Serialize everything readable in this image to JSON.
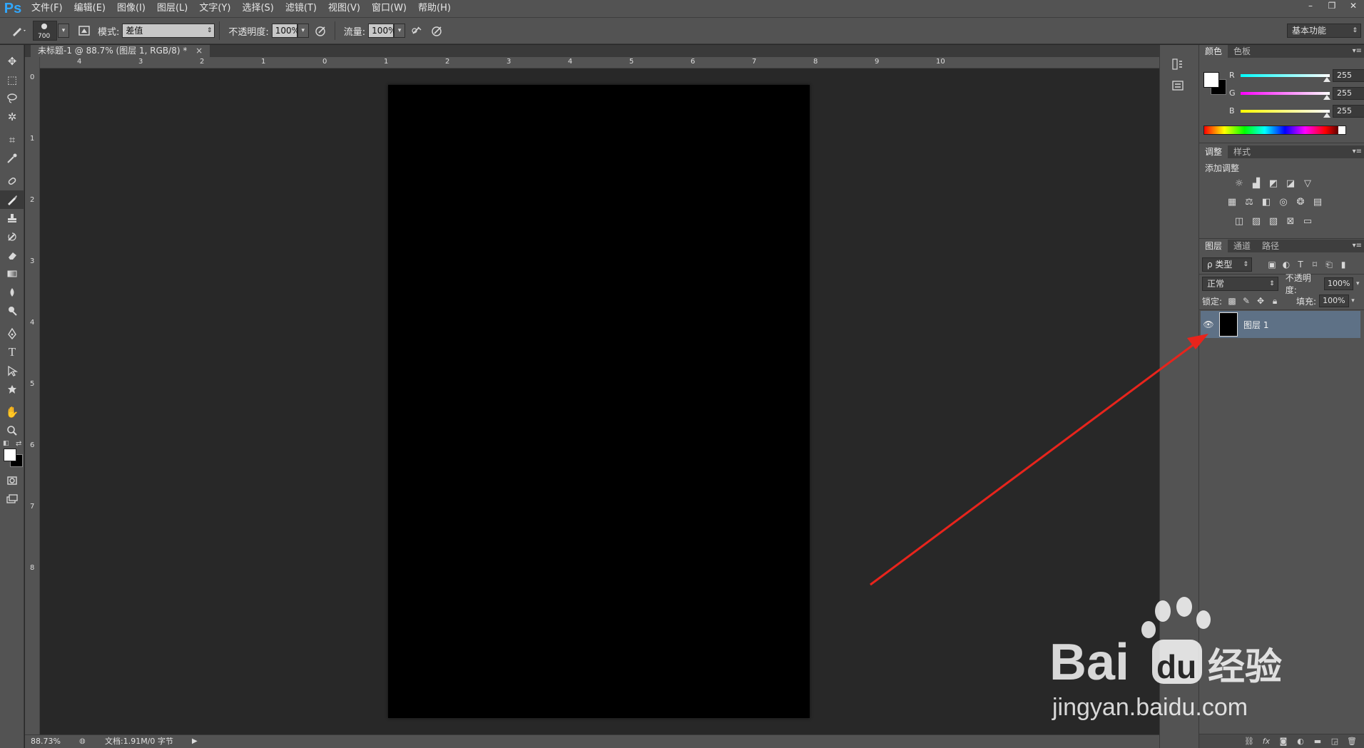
{
  "app": {
    "logo": "Ps"
  },
  "menu": [
    "文件(F)",
    "编辑(E)",
    "图像(I)",
    "图层(L)",
    "文字(Y)",
    "选择(S)",
    "滤镜(T)",
    "视图(V)",
    "窗口(W)",
    "帮助(H)"
  ],
  "window_controls": {
    "minimize": "–",
    "restore": "❐",
    "close": "✕"
  },
  "options": {
    "brush_size": "700",
    "mode_label": "模式:",
    "mode_value": "差值",
    "opacity_label": "不透明度:",
    "opacity_value": "100%",
    "flow_label": "流量:",
    "flow_value": "100%",
    "workspace": "基本功能"
  },
  "document": {
    "tab_title": "未标题-1 @ 88.7% (图层 1, RGB/8) *",
    "close": "×",
    "canvas_color": "#000000"
  },
  "rulers": {
    "h_labels": [
      "4",
      "3",
      "2",
      "1",
      "0",
      "1",
      "2",
      "3",
      "4",
      "5",
      "6",
      "7",
      "8",
      "9",
      "10"
    ],
    "v_labels": [
      "0",
      "1",
      "2",
      "3",
      "4",
      "5",
      "6",
      "7",
      "8"
    ]
  },
  "status": {
    "zoom": "88.73%",
    "doc_info": "文档:1.91M/0 字节"
  },
  "panels": {
    "color": {
      "tabs": [
        "颜色",
        "色板"
      ],
      "channels": [
        {
          "label": "R",
          "value": "255",
          "color": "#00ffff"
        },
        {
          "label": "G",
          "value": "255",
          "color": "#ff00ff"
        },
        {
          "label": "B",
          "value": "255",
          "color": "#ffff00"
        }
      ],
      "foreground": "#ffffff",
      "background": "#000000"
    },
    "adjustments": {
      "tabs": [
        "调整",
        "样式"
      ],
      "title": "添加调整"
    },
    "layers": {
      "tabs": [
        "图层",
        "通道",
        "路径"
      ],
      "filter_label": "ρ 类型",
      "blend_mode": "正常",
      "opacity_label": "不透明度:",
      "opacity_value": "100%",
      "lock_label": "锁定:",
      "fill_label": "填充:",
      "fill_value": "100%",
      "items": [
        {
          "name": "图层 1",
          "visible": true
        }
      ]
    }
  },
  "watermark": {
    "brand": "Bai",
    "brand2": "du",
    "product": "经验",
    "url": "jingyan.baidu.com"
  },
  "colors": {
    "annotation_arrow": "#e8241c",
    "selected_layer": "#5e7186"
  }
}
